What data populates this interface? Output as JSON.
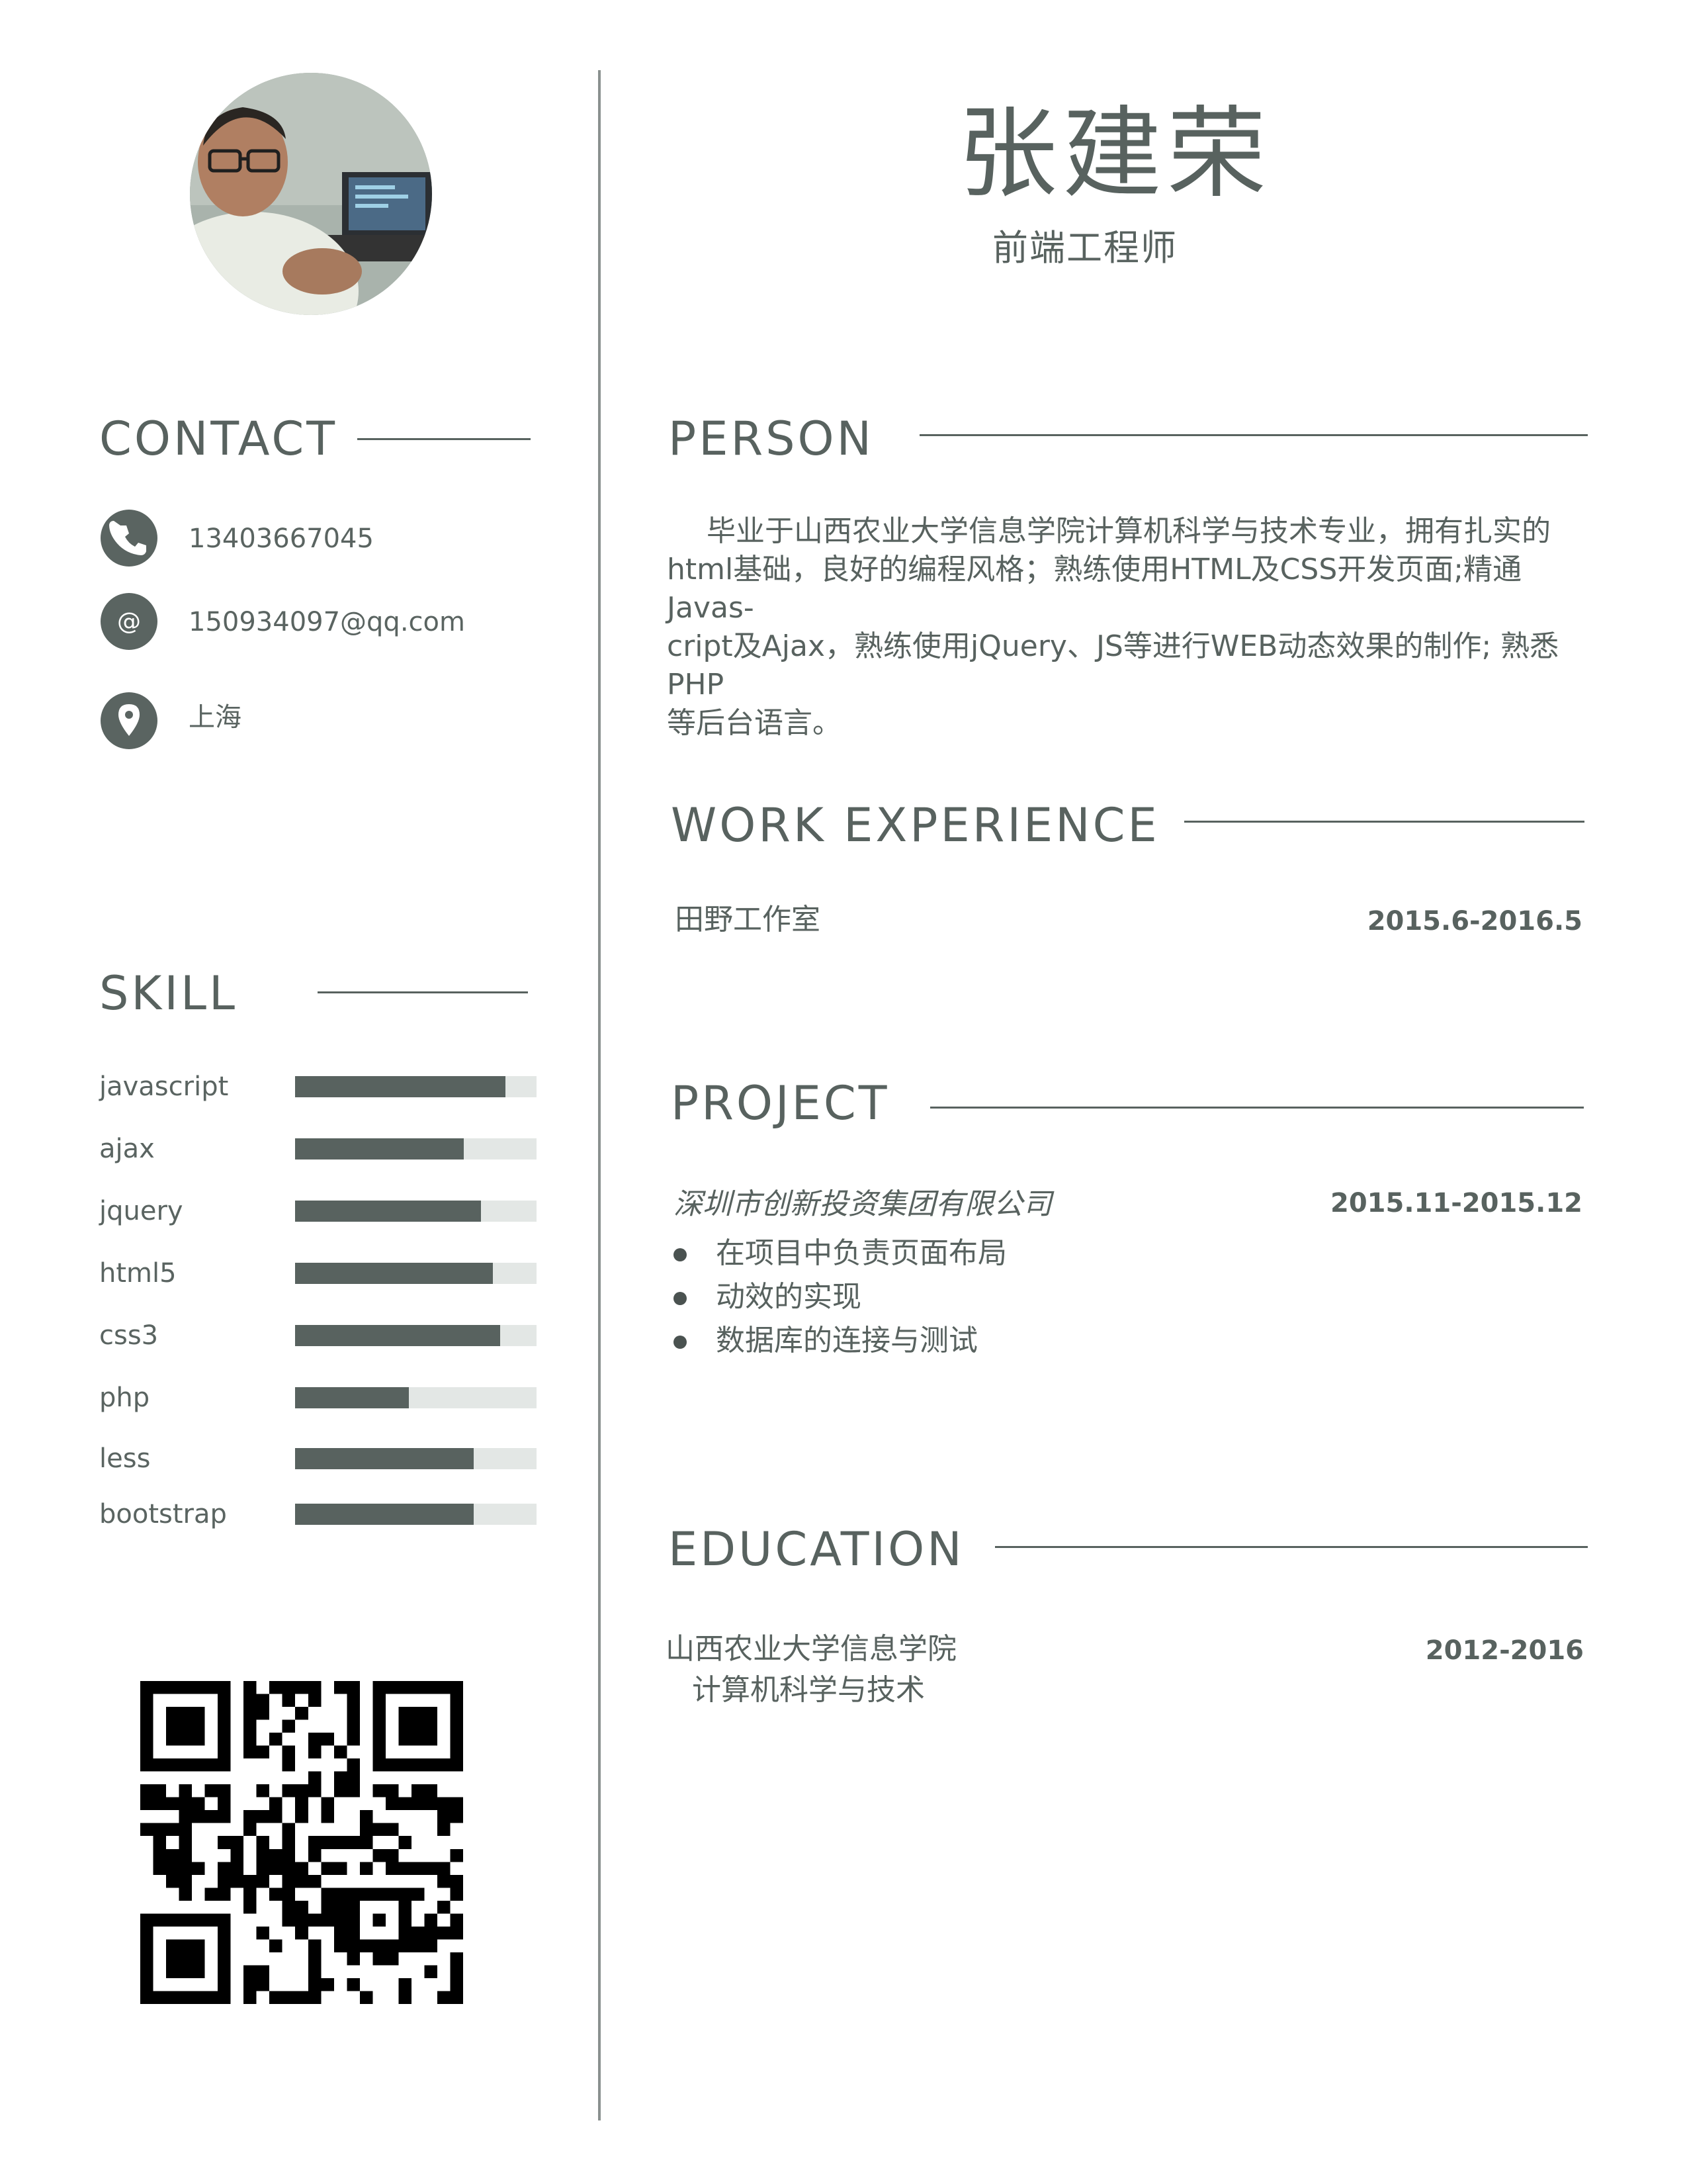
{
  "header": {
    "name": "张建荣",
    "role": "前端工程师"
  },
  "contact": {
    "title": "CONTACT",
    "phone": "13403667045",
    "email": "150934097@qq.com",
    "location": "上海",
    "icons": [
      "phone-icon",
      "at-icon",
      "location-pin-icon"
    ]
  },
  "skills": {
    "title": "SKILL",
    "items": [
      {
        "label": "javascript",
        "level": 0.87
      },
      {
        "label": "ajax",
        "level": 0.7
      },
      {
        "label": "jquery",
        "level": 0.77
      },
      {
        "label": "html5",
        "level": 0.82
      },
      {
        "label": "css3",
        "level": 0.85
      },
      {
        "label": "php",
        "level": 0.47
      },
      {
        "label": "less",
        "level": 0.74
      },
      {
        "label": "bootstrap",
        "level": 0.74
      }
    ]
  },
  "person": {
    "title": "PERSON",
    "lines": [
      "毕业于山西农业大学信息学院计算机科学与技术专业，拥有扎实的",
      "html基础，良好的编程风格；熟练使用HTML及CSS开发页面;精通Javas-",
      "cript及Ajax，熟练使用jQuery、JS等进行WEB动态效果的制作; 熟悉PHP",
      "等后台语言。"
    ]
  },
  "work": {
    "title": "WORK EXPERIENCE",
    "company": "田野工作室",
    "date": "2015.6-2016.5"
  },
  "project": {
    "title": "PROJECT",
    "company": "深圳市创新投资集团有限公司",
    "date": "2015.11-2015.12",
    "bullets": [
      "在项目中负责页面布局",
      "动效的实现",
      "数据库的连接与测试"
    ]
  },
  "education": {
    "title": "EDUCATION",
    "school": "山西农业大学信息学院",
    "major": "计算机科学与技术",
    "date": "2012-2016"
  },
  "colors": {
    "accent": "#58625f",
    "track": "#e3e7e5",
    "background": "#ffffff"
  }
}
